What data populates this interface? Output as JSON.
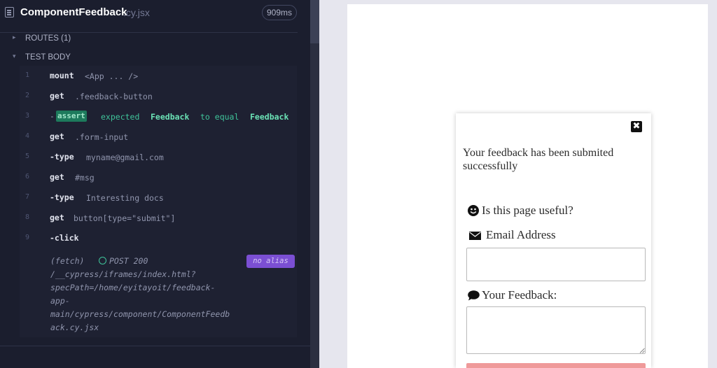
{
  "reporter": {
    "spec_name": "ComponentFeedback",
    "spec_ext": ".cy.jsx",
    "duration": "909ms",
    "sections": {
      "routes": "ROUTES (1)",
      "test_body": "TEST BODY"
    },
    "commands": [
      {
        "num": "1",
        "name": "mount",
        "message": "<App ... />"
      },
      {
        "num": "2",
        "name": "get",
        "message": ".feedback-button"
      },
      {
        "num": "3",
        "name": "-",
        "badge": "assert",
        "expected": "expected",
        "subject": "Feedback",
        "to_equal": "to equal",
        "value": "Feedback"
      },
      {
        "num": "4",
        "name": "get",
        "message": ".form-input"
      },
      {
        "num": "5",
        "name": "-type",
        "message": "myname@gmail.com"
      },
      {
        "num": "6",
        "name": "get",
        "message": "#msg"
      },
      {
        "num": "7",
        "name": "-type",
        "message": "Interesting docs"
      },
      {
        "num": "8",
        "name": "get",
        "message": "button[type=\"submit\"]"
      },
      {
        "num": "9",
        "name": "-click",
        "message": ""
      }
    ],
    "xhr": {
      "type": "(fetch)",
      "method_status": "POST 200",
      "alias": "no alias",
      "url_lines": [
        "/__cypress/iframes/index.html?",
        "specPath=/home/eyitayoit/feedback-",
        "app-",
        "main/cypress/component/ComponentFeedb",
        "ack.cy.jsx"
      ]
    },
    "colors": {
      "panel_bg": "#1b1e2e",
      "assert_badge": "#1d7a5c",
      "assert_text": "#3fc49a",
      "alias_badge": "#7b4fd3"
    }
  },
  "aut": {
    "close_icon": "close-icon",
    "success_message": "Your feedback has been submited successfully",
    "useful_question": "Is this page useful?",
    "email_label": "Email Address",
    "email_value": "",
    "feedback_label": "Your Feedback:",
    "feedback_value": "",
    "icons": [
      "smile-icon",
      "envelope-icon",
      "comment-icon"
    ],
    "colors": {
      "submit_button": "#ef9a9a"
    }
  }
}
